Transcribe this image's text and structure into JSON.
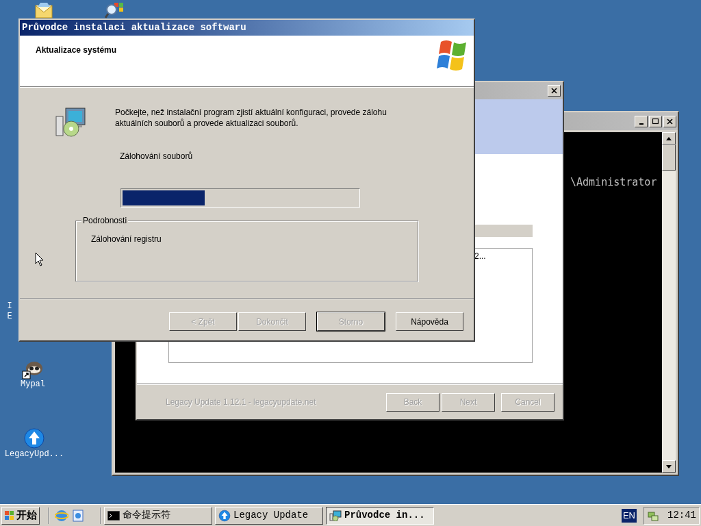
{
  "desktop_icons": [
    {
      "kind": "mail"
    },
    {
      "kind": "search"
    },
    {
      "kind": "cut",
      "label_lines": [
        "I",
        "E"
      ]
    },
    {
      "kind": "mypal",
      "label_lines": [
        "Mypal"
      ]
    },
    {
      "kind": "legacy",
      "label_lines": [
        "LegacyUpd..."
      ]
    }
  ],
  "console_window": {
    "text": "\\Administrator"
  },
  "legacy_update_window": {
    "list_text": "2...",
    "footer": "Legacy Update 1.12.1 - legacyupdate.net",
    "buttons": [
      {
        "label": "Back",
        "disabled": true
      },
      {
        "label": "Next",
        "disabled": true
      },
      {
        "label": "Cancel",
        "disabled": true
      }
    ]
  },
  "wizard": {
    "title": "Průvodce instalaci aktualizace softwaru",
    "header": "Aktualizace systému",
    "description": "Počkejte, než instalační program zjistí aktuální konfiguraci, provede zálohu aktuálních souborů a provede aktualizaci souborů.",
    "status": "Zálohování souborů",
    "progress": {
      "level": 0.35
    },
    "details": {
      "legend": "Podrobnosti",
      "text": "Zálohování registru"
    },
    "buttons": [
      {
        "label": "< Zpět",
        "disabled": true,
        "default": false
      },
      {
        "label": "Dokončit",
        "disabled": true,
        "default": false
      },
      {
        "label": "Storno",
        "disabled": true,
        "default": true
      },
      {
        "label": "Nápověda",
        "disabled": false,
        "default": false
      }
    ]
  },
  "taskbar": {
    "start": "开始",
    "tasks": [
      {
        "kind": "console",
        "label": "命令提示符",
        "selected": false
      },
      {
        "kind": "legacy",
        "label": "Legacy Update",
        "selected": false
      },
      {
        "kind": "setup",
        "label": "Průvodce in...",
        "selected": true
      }
    ],
    "language": "EN",
    "clock": "12:41"
  }
}
